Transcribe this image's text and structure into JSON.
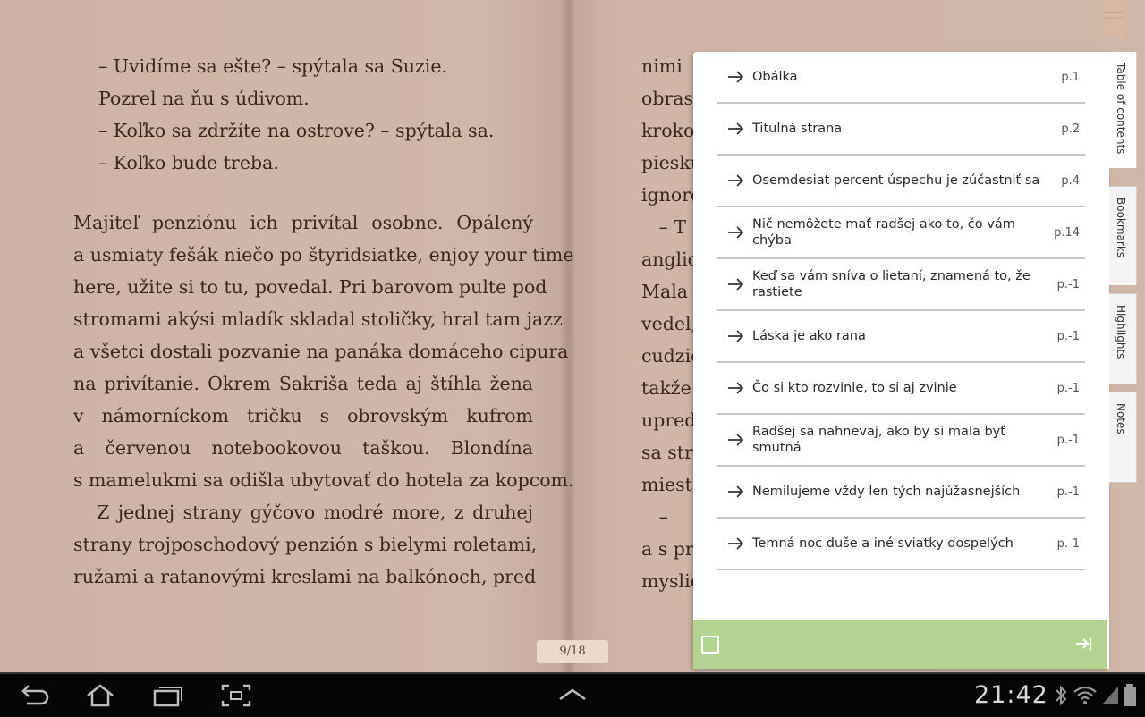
{
  "book": {
    "left_dialog": [
      "– Uvidíme sa ešte? – spýtala sa Suzie.",
      "Pozrel na ňu s údivom.",
      "– Koľko sa zdržíte na ostrove? – spýtala sa.",
      "– Koľko bude treba."
    ],
    "left_paragraph": [
      "Majiteľ penziónu ich privítal osobne. Opálený",
      "a usmiaty fešák niečo po štyridsiatke, enjoy your time",
      "here, užite si to tu, povedal. Pri barovom pulte pod",
      "stromami akýsi mladík skladal stoličky, hral tam jazz",
      "a všetci dostali pozvanie na panáka domáceho cipura",
      "na privítanie. Okrem Sakriša teda aj štíhla žena",
      "v námorníckom tričku s obrovským kufrom",
      "a červenou notebookovou taškou. Blondína",
      "s mamelukmi sa odišla ubytovať do hotela za kopcom.",
      "Z jednej strany gýčovo modré more, z druhej",
      "strany trojposchodový penzión s bielymi roletami,",
      "ružami a ratanovými kreslami na balkónoch, pred"
    ],
    "right_fragments": [
      "nimi",
      "obrast",
      "krokon",
      "piesku",
      "ignoro",
      "   – T",
      "anglic",
      "Mala p",
      "vedel,",
      "cudzie",
      "takže",
      "upredr",
      "sa strá",
      "mieste",
      "   –",
      "a s prí",
      "myslie"
    ],
    "page_indicator": "9/18"
  },
  "panel": {
    "toc": [
      {
        "title": "Obálka",
        "page": "p.1"
      },
      {
        "title": "Titulná strana",
        "page": "p.2"
      },
      {
        "title": "Osemdesiat percent úspechu je zúčastniť sa",
        "page": "p.4"
      },
      {
        "title": "Nič nemôžete mať radšej ako to, čo vám chýba",
        "page": "p.14"
      },
      {
        "title": "Keď sa vám sníva o lietaní, znamená to, že rastiete",
        "page": "p.-1"
      },
      {
        "title": "Láska je ako rana",
        "page": "p.-1"
      },
      {
        "title": "Čo si kto rozvinie, to si aj zvinie",
        "page": "p.-1"
      },
      {
        "title": "Radšej sa nahnevaj, ako by si mala byť smutná",
        "page": "p.-1"
      },
      {
        "title": "Nemilujeme vždy len tých najúžasnejších",
        "page": "p.-1"
      },
      {
        "title": "Temná noc duše a iné sviatky dospelých",
        "page": "p.-1"
      }
    ],
    "tabs": [
      {
        "label": "Table of contents"
      },
      {
        "label": "Bookmarks"
      },
      {
        "label": "Highlights"
      },
      {
        "label": "Notes"
      }
    ]
  },
  "status": {
    "time": "21:42"
  },
  "colors": {
    "page": "#cfb6a8",
    "text": "#3c2822",
    "footer_green": "#b3d391",
    "navbar": "#050505"
  }
}
